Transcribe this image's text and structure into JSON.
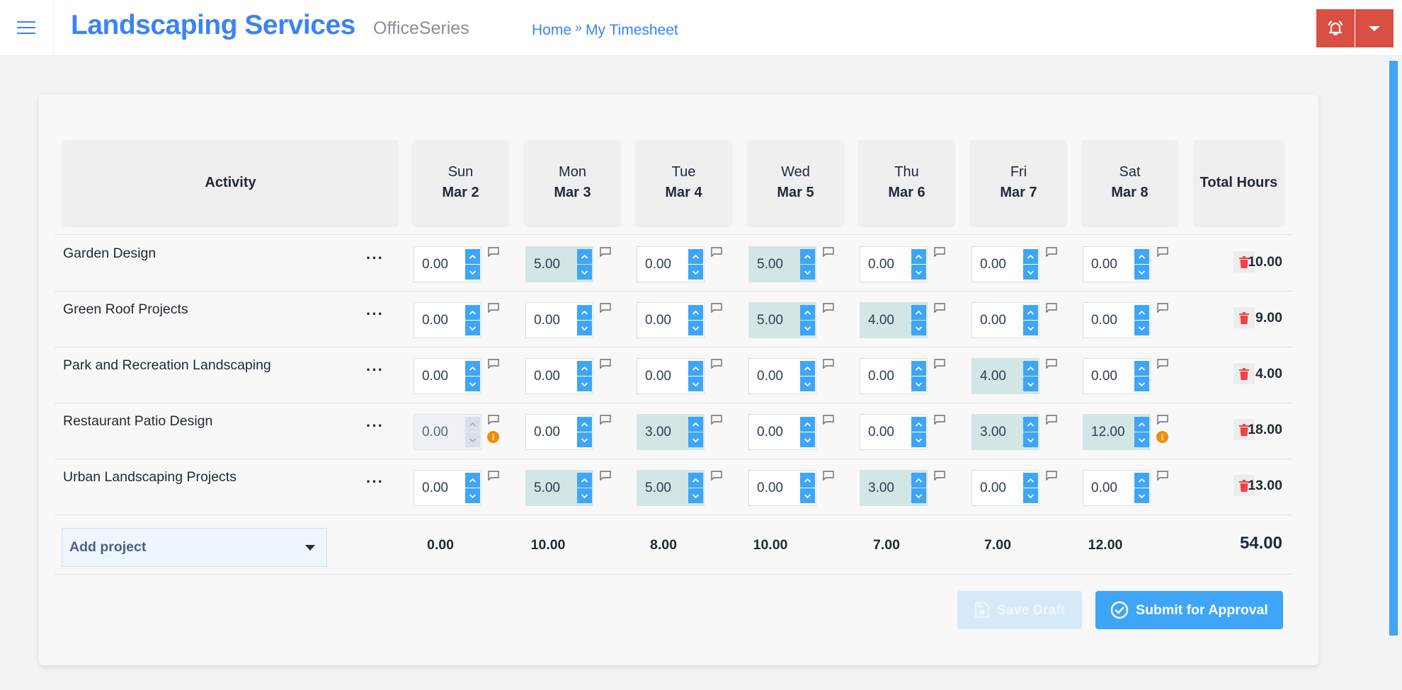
{
  "header": {
    "app_title": "Landscaping Services",
    "app_subtitle": "OfficeSeries",
    "breadcrumb": [
      {
        "label": "Home"
      },
      {
        "label": "My Timesheet"
      }
    ],
    "breadcrumb_separator": "»",
    "accent_color": "#3b82f6",
    "alert_color": "#d94f43"
  },
  "table": {
    "activity_header": "Activity",
    "total_header": "Total Hours",
    "days": [
      {
        "day": "Sun",
        "date": "Mar 2"
      },
      {
        "day": "Mon",
        "date": "Mar 3"
      },
      {
        "day": "Tue",
        "date": "Mar 4"
      },
      {
        "day": "Wed",
        "date": "Mar 5"
      },
      {
        "day": "Thu",
        "date": "Mar 6"
      },
      {
        "day": "Fri",
        "date": "Mar 7"
      },
      {
        "day": "Sat",
        "date": "Mar 8"
      }
    ],
    "rows": [
      {
        "activity": "Garden Design",
        "menu": "···",
        "hours": [
          "0.00",
          "5.00",
          "0.00",
          "5.00",
          "0.00",
          "0.00",
          "0.00"
        ],
        "filled": [
          false,
          true,
          false,
          true,
          false,
          false,
          false
        ],
        "disabled": [
          false,
          false,
          false,
          false,
          false,
          false,
          false
        ],
        "info": [
          false,
          false,
          false,
          false,
          false,
          false,
          false
        ],
        "total": "10.00"
      },
      {
        "activity": "Green Roof Projects",
        "menu": "···",
        "hours": [
          "0.00",
          "0.00",
          "0.00",
          "5.00",
          "4.00",
          "0.00",
          "0.00"
        ],
        "filled": [
          false,
          false,
          false,
          true,
          true,
          false,
          false
        ],
        "disabled": [
          false,
          false,
          false,
          false,
          false,
          false,
          false
        ],
        "info": [
          false,
          false,
          false,
          false,
          false,
          false,
          false
        ],
        "total": "9.00"
      },
      {
        "activity": "Park and Recreation Landscaping",
        "menu": "···",
        "hours": [
          "0.00",
          "0.00",
          "0.00",
          "0.00",
          "0.00",
          "4.00",
          "0.00"
        ],
        "filled": [
          false,
          false,
          false,
          false,
          false,
          true,
          false
        ],
        "disabled": [
          false,
          false,
          false,
          false,
          false,
          false,
          false
        ],
        "info": [
          false,
          false,
          false,
          false,
          false,
          false,
          false
        ],
        "total": "4.00"
      },
      {
        "activity": "Restaurant Patio Design",
        "menu": "···",
        "hours": [
          "0.00",
          "0.00",
          "3.00",
          "0.00",
          "0.00",
          "3.00",
          "12.00"
        ],
        "filled": [
          false,
          false,
          true,
          false,
          false,
          true,
          true
        ],
        "disabled": [
          true,
          false,
          false,
          false,
          false,
          false,
          false
        ],
        "info": [
          true,
          false,
          false,
          false,
          false,
          false,
          true
        ],
        "total": "18.00"
      },
      {
        "activity": "Urban Landscaping Projects",
        "menu": "···",
        "hours": [
          "0.00",
          "5.00",
          "5.00",
          "0.00",
          "3.00",
          "0.00",
          "0.00"
        ],
        "filled": [
          false,
          true,
          true,
          false,
          true,
          false,
          false
        ],
        "disabled": [
          false,
          false,
          false,
          false,
          false,
          false,
          false
        ],
        "info": [
          false,
          false,
          false,
          false,
          false,
          false,
          false
        ],
        "total": "13.00"
      }
    ],
    "day_totals": [
      "0.00",
      "10.00",
      "8.00",
      "10.00",
      "7.00",
      "7.00",
      "12.00"
    ],
    "grand_total": "54.00",
    "info_glyph": "i"
  },
  "footer": {
    "add_project_label": "Add project",
    "save_draft_label": "Save Draft",
    "submit_label": "Submit for Approval"
  }
}
